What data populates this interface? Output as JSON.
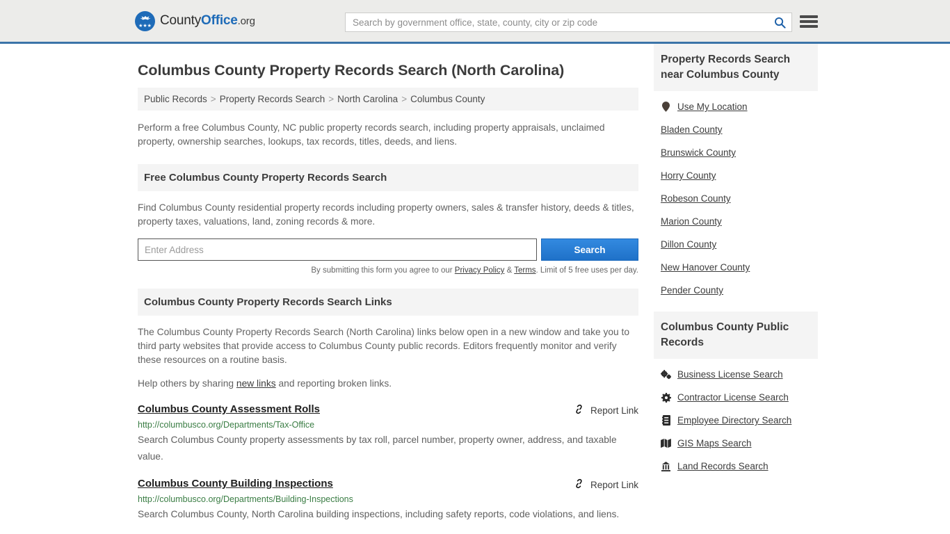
{
  "header": {
    "logo": {
      "part1": "County",
      "part2": "Office",
      "part3": ".org",
      "icon": "eagle-seal-icon",
      "stars": "★★★"
    },
    "search": {
      "placeholder": "Search by government office, state, county, city or zip code",
      "value": "",
      "icon": "search-icon"
    },
    "menu_icon": "hamburger-menu-icon",
    "accent_color": "#1e6bb8",
    "border_color": "#3b74a8"
  },
  "page_title": "Columbus County Property Records Search (North Carolina)",
  "breadcrumb": {
    "items": [
      {
        "label": "Public Records",
        "current": false
      },
      {
        "label": "Property Records Search",
        "current": false
      },
      {
        "label": "North Carolina",
        "current": false
      },
      {
        "label": "Columbus County",
        "current": true
      }
    ],
    "separator": ">"
  },
  "lead": "Perform a free Columbus County, NC public property records search, including property appraisals, unclaimed property, ownership searches, lookups, tax records, titles, deeds, and liens.",
  "free_search": {
    "heading": "Free Columbus County Property Records Search",
    "body": "Find Columbus County residential property records including property owners, sales & transfer history, deeds & titles, property taxes, valuations, land, zoning records & more.",
    "input_placeholder": "Enter Address",
    "input_value": "",
    "button_label": "Search",
    "note_prefix": "By submitting this form you agree to our ",
    "note_privacy": "Privacy Policy",
    "note_amp": " & ",
    "note_terms": "Terms",
    "note_suffix": ". Limit of 5 free uses per day.",
    "button_color": "#2b7fd6"
  },
  "links_section": {
    "heading": "Columbus County Property Records Search Links",
    "paragraph": "The Columbus County Property Records Search (North Carolina) links below open in a new window and take you to third party websites that provide access to Columbus County public records. Editors frequently monitor and verify these resources on a routine basis.",
    "help_prefix": "Help others by sharing ",
    "help_link": "new links",
    "help_suffix": " and reporting broken links.",
    "report_label": "Report Link",
    "report_icon": "broken-link-icon",
    "url_color": "#3a7d44"
  },
  "results": [
    {
      "title": "Columbus County Assessment Rolls",
      "url": "http://columbusco.org/Departments/Tax-Office",
      "description": "Search Columbus County property assessments by tax roll, parcel number, property owner, address, and taxable value."
    },
    {
      "title": "Columbus County Building Inspections",
      "url": "http://columbusco.org/Departments/Building-Inspections",
      "description": "Search Columbus County, North Carolina building inspections, including safety reports, code violations, and liens."
    }
  ],
  "sidebar": {
    "near_section": {
      "heading": "Property Records Search near Columbus County",
      "items": [
        {
          "label": "Use My Location",
          "icon": "map-pin-icon"
        },
        {
          "label": "Bladen County",
          "icon": ""
        },
        {
          "label": "Brunswick County",
          "icon": ""
        },
        {
          "label": "Horry County",
          "icon": ""
        },
        {
          "label": "Robeson County",
          "icon": ""
        },
        {
          "label": "Marion County",
          "icon": ""
        },
        {
          "label": "Dillon County",
          "icon": ""
        },
        {
          "label": "New Hanover County",
          "icon": ""
        },
        {
          "label": "Pender County",
          "icon": ""
        }
      ]
    },
    "public_records_section": {
      "heading": "Columbus County Public Records",
      "items": [
        {
          "label": "Business License Search",
          "icon": "cogs-icon"
        },
        {
          "label": "Contractor License Search",
          "icon": "cog-icon"
        },
        {
          "label": "Employee Directory Search",
          "icon": "address-book-icon"
        },
        {
          "label": "GIS Maps Search",
          "icon": "map-icon"
        },
        {
          "label": "Land Records Search",
          "icon": "landmark-icon"
        }
      ]
    }
  }
}
